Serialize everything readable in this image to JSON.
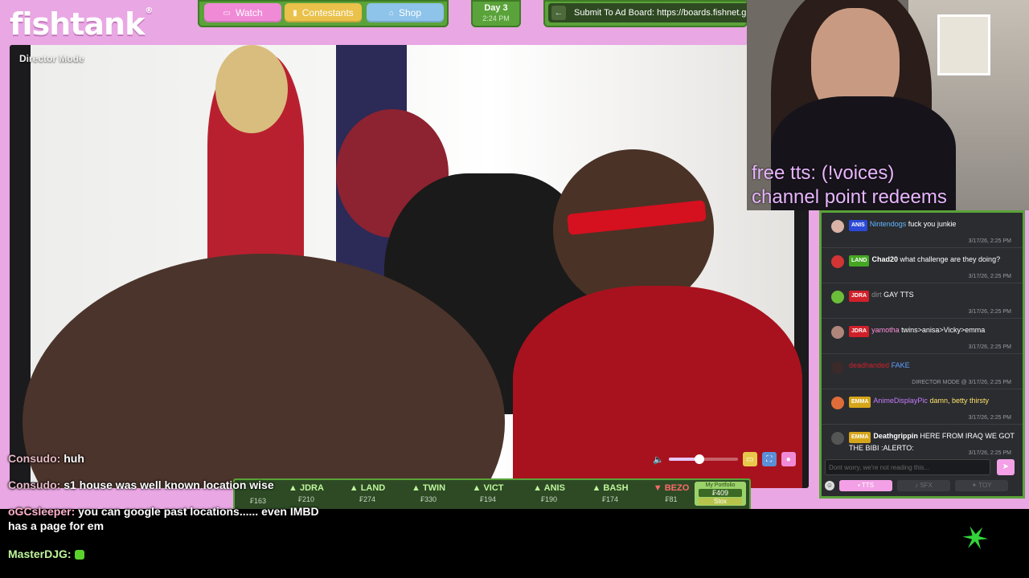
{
  "brand": {
    "logo": "fishtank",
    "mark": "®"
  },
  "nav": {
    "watch": "Watch",
    "contestants": "Contestants",
    "shop": "Shop"
  },
  "clock": {
    "day": "Day 3",
    "time": "2:24 PM"
  },
  "adboard": {
    "text": "Submit To Ad Board: https://boards.fishnet.g"
  },
  "video": {
    "mode_label": "Director Mode",
    "volume_level": 0.45
  },
  "ticker": {
    "items": [
      {
        "name": "JDRA",
        "price": "₣210",
        "trend": "up"
      },
      {
        "name": "LAND",
        "price": "₣274",
        "trend": "up"
      },
      {
        "name": "TWIN",
        "price": "₣330",
        "trend": "up"
      },
      {
        "name": "VICT",
        "price": "₣194",
        "trend": "up"
      },
      {
        "name": "ANIS",
        "price": "₣190",
        "trend": "up"
      },
      {
        "name": "BASH",
        "price": "₣174",
        "trend": "up"
      },
      {
        "name": "BEZO",
        "price": "₣81",
        "trend": "down"
      }
    ],
    "hidden_price": "₣163",
    "portfolio": {
      "label": "My Portfolio",
      "value": "₣409",
      "stox": "Stox"
    }
  },
  "stream_chat": [
    {
      "user": "Consudo:",
      "text": "huh"
    },
    {
      "user": "Consudo:",
      "text": "s1 house was well known location wise"
    },
    {
      "user": "oGCsleeper:",
      "text": "you can google past locations...... even IMBD has a page for em"
    },
    {
      "user": "MasterDJG:",
      "text": ""
    }
  ],
  "webcam": {
    "caption_line1": "free tts: (!voices)",
    "caption_line2": "channel point redeems"
  },
  "chat_panel": {
    "messages": [
      {
        "tag": "ANIS",
        "tag_color": "#2b49d6",
        "user": "Nintendogs",
        "user_color": "#62b6ff",
        "text": "fuck you junkie",
        "time": "3/17/26, 2:25 PM",
        "meta": "",
        "avatar": "#d9b3a6"
      },
      {
        "tag": "LAND",
        "tag_color": "#45a623",
        "user": "Chad20",
        "user_color": "#ffffff",
        "text": "what challenge are they doing?",
        "time": "3/17/26, 2:25 PM",
        "meta": "",
        "avatar": "#d33434"
      },
      {
        "tag": "JDRA",
        "tag_color": "#d0202a",
        "user": "dirt",
        "user_color": "#8c8c8c",
        "text": "GAY TTS",
        "time": "3/17/26, 2:25 PM",
        "meta": "",
        "avatar": "#6bbd3a"
      },
      {
        "tag": "JDRA",
        "tag_color": "#d0202a",
        "user": "yamotha",
        "user_color": "#ff8fd9",
        "text": "twins>anisa>Vicky>emma",
        "time": "3/17/26, 2:25 PM",
        "meta": "",
        "avatar": "#b0857a"
      },
      {
        "tag": "",
        "tag_color": "",
        "user": "deadhanded",
        "user_color": "#d0202a",
        "text": "FAKE",
        "time": "3/17/26, 2:25 PM",
        "meta": "DIRECTOR MODE @",
        "avatar": "#3b2a2a"
      },
      {
        "tag": "EMMA",
        "tag_color": "#d6a51a",
        "user": "AnimeDisplayPic",
        "user_color": "#c77bff",
        "text": "damn, betty thirsty",
        "time": "3/17/26, 2:25 PM",
        "meta": "",
        "avatar": "#e06c3a"
      },
      {
        "tag": "EMMA",
        "tag_color": "#d6a51a",
        "user": "Deathgrippin",
        "user_color": "#ffffff",
        "text": "HERE FROM IRAQ WE GOT THE BIBI :ALERTO:",
        "time": "3/17/26, 2:25 PM",
        "meta": "",
        "avatar": "#555555"
      }
    ],
    "input_placeholder": "Dont worry, we're not reading this...",
    "tabs": {
      "tts": "TTS",
      "sfx": "SFX",
      "toy": "TOY"
    }
  },
  "colors": {
    "frame": "#e9a7e4",
    "accent_green": "#5aa33a",
    "accent_pink": "#f3a0e6"
  }
}
